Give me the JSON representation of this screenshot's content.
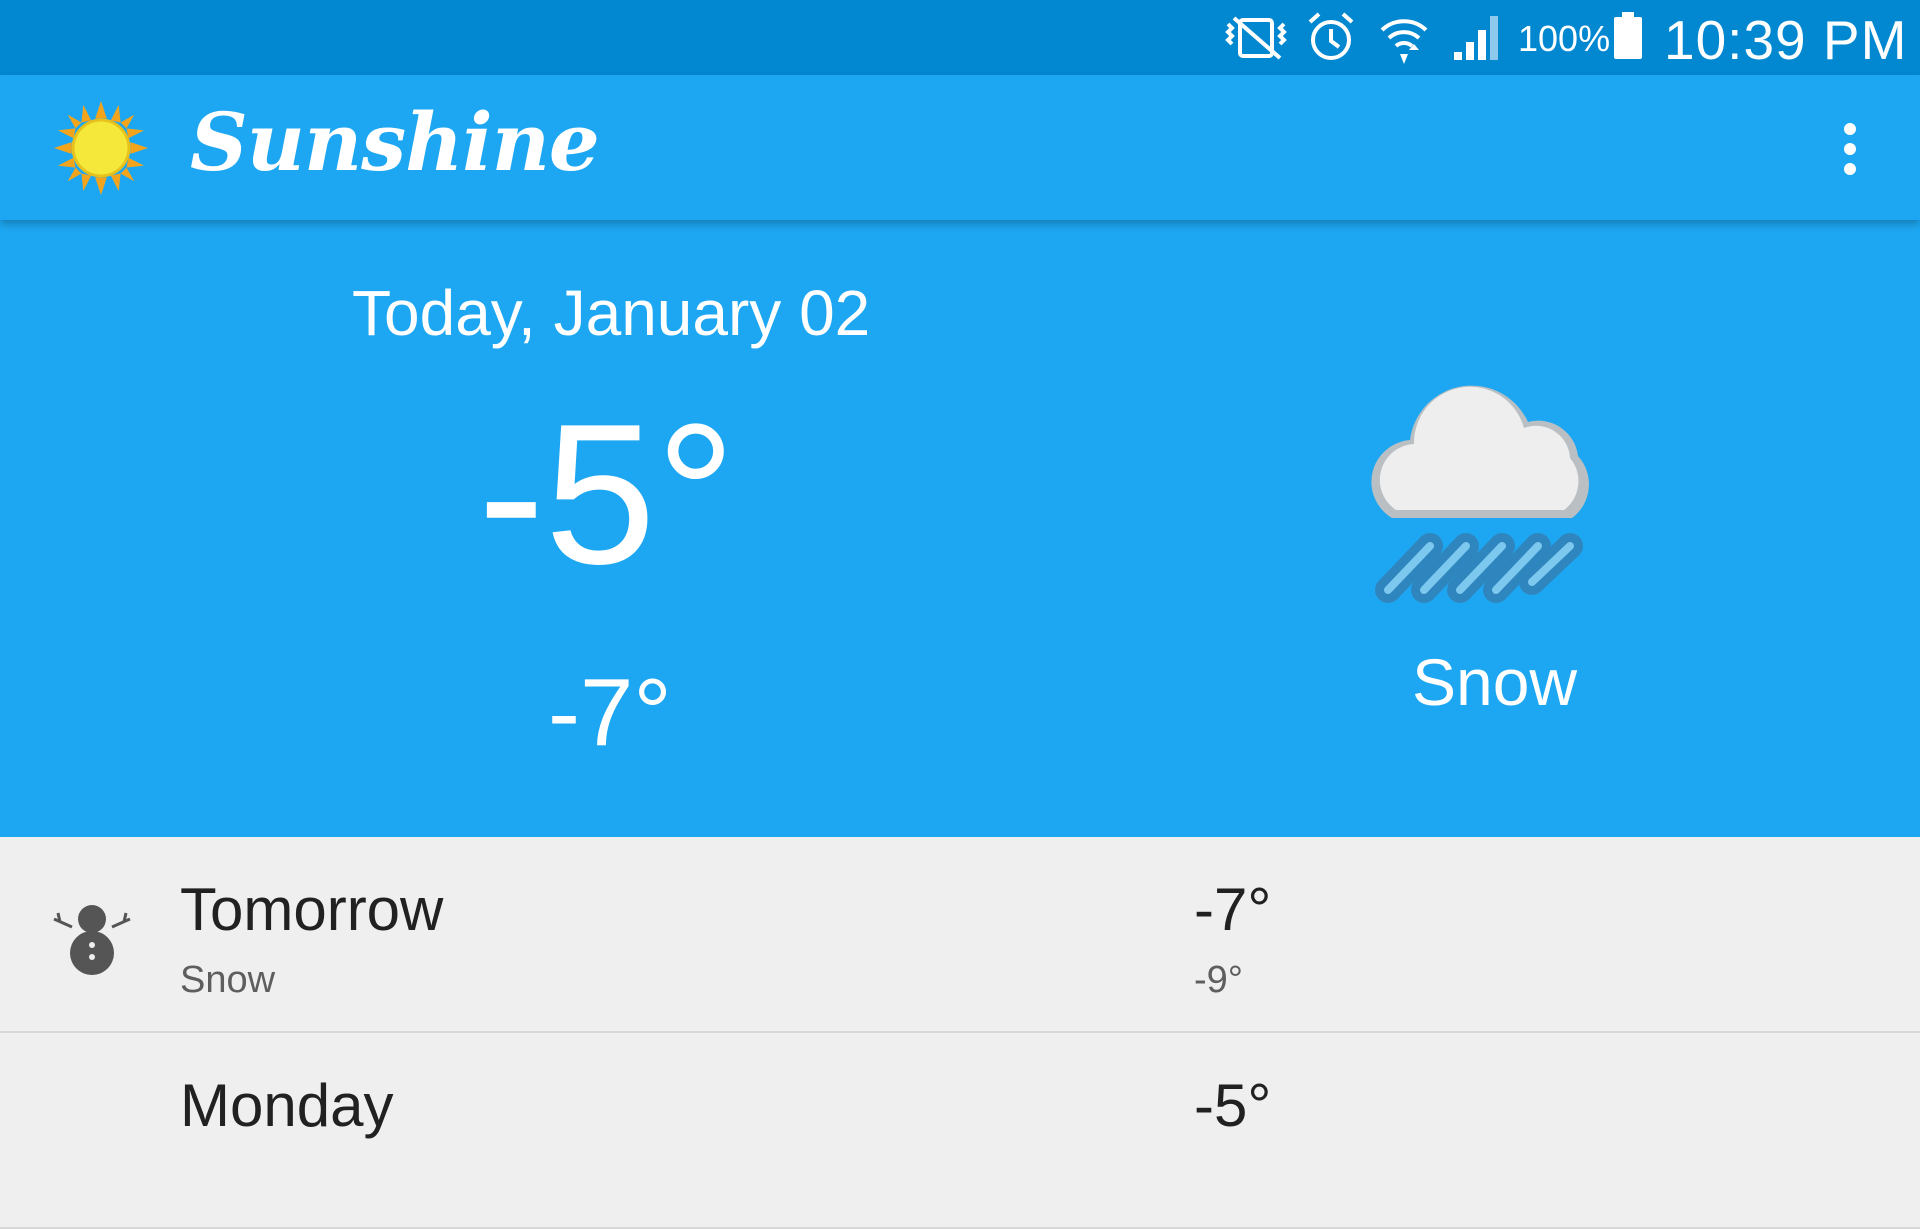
{
  "status_bar": {
    "icons": [
      "vibrate-mute-icon",
      "alarm-icon",
      "wifi-icon",
      "signal-icon",
      "battery-icon"
    ],
    "battery_percent": "100%",
    "time": "10:39 PM"
  },
  "app_bar": {
    "title": "Sunshine",
    "logo_icon": "sun-icon",
    "menu_icon": "overflow-menu-icon"
  },
  "today": {
    "date": "Today, January 02",
    "high": "-5°",
    "low": "-7°",
    "description": "Snow",
    "icon": "snow-cloud-icon"
  },
  "forecast": [
    {
      "day": "Tomorrow",
      "description": "Snow",
      "high": "-7°",
      "low": "-9°",
      "icon": "snowman-icon"
    },
    {
      "day": "Monday",
      "description": "",
      "high": "-5°",
      "low": "",
      "icon": ""
    }
  ],
  "colors": {
    "status_bar": "#0288d1",
    "primary": "#1da7f2",
    "list_background": "#efefef",
    "primary_text": "#212121",
    "secondary_text": "#5e5e5e"
  }
}
